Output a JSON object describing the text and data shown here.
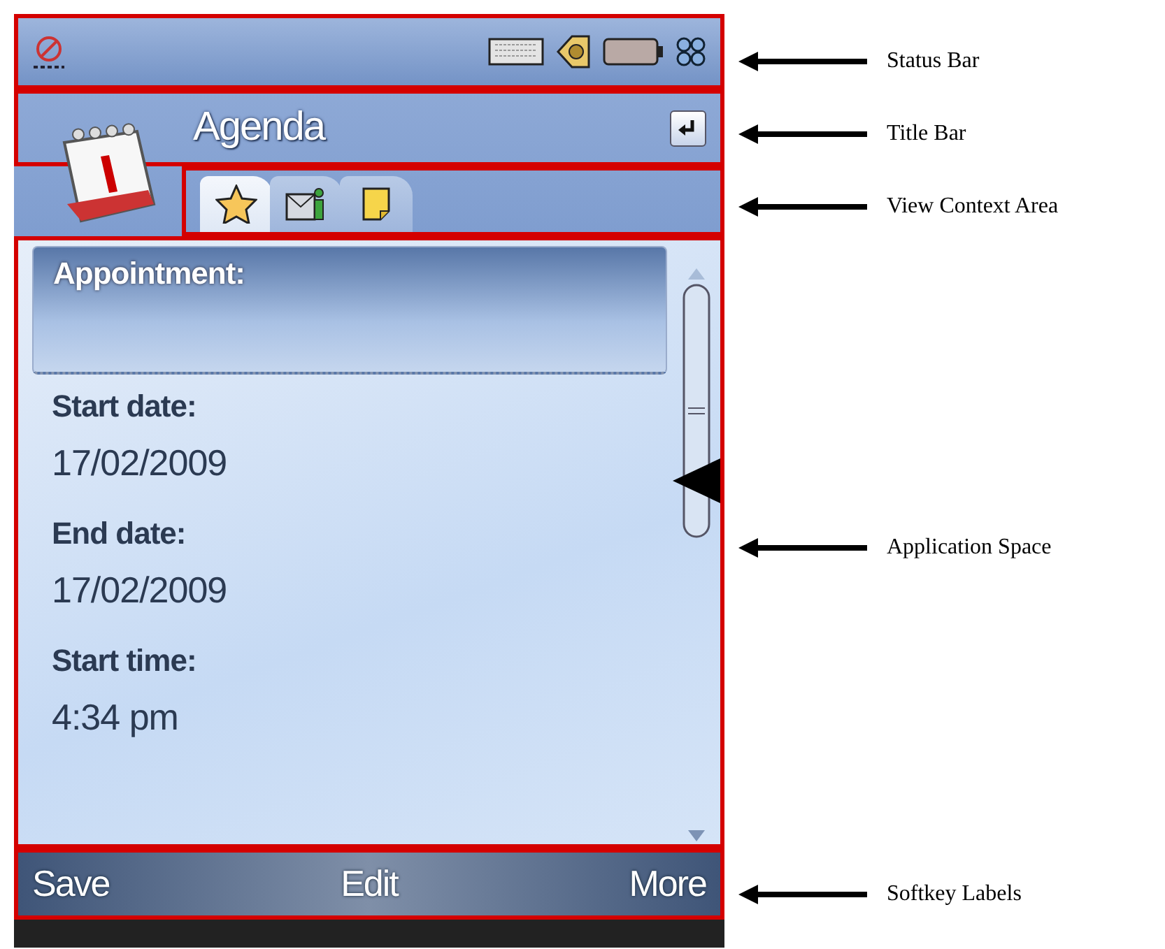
{
  "title_bar": {
    "title": "Agenda"
  },
  "tabs": [
    {
      "kind": "star",
      "selected": true
    },
    {
      "kind": "contact",
      "selected": false
    },
    {
      "kind": "note",
      "selected": false
    }
  ],
  "fields": [
    {
      "label": "Appointment:",
      "selected": true
    },
    {
      "label": "Start date:",
      "value": "17/02/2009",
      "selected": false
    },
    {
      "label": "End date:",
      "value": "17/02/2009",
      "selected": false
    },
    {
      "label": "Start time:",
      "value": "4:34 pm",
      "selected": false
    }
  ],
  "softkeys": [
    "Save",
    "Edit",
    "More"
  ],
  "annotations": [
    {
      "label": "Status Bar"
    },
    {
      "label": "Title Bar"
    },
    {
      "label": "View Context Area"
    },
    {
      "label": "Application Space"
    },
    {
      "label": "Softkey Labels"
    }
  ]
}
